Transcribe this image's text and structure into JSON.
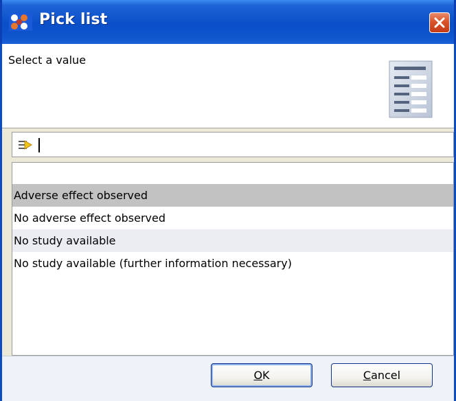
{
  "window": {
    "title": "Pick list",
    "accent": "#0a4fc8",
    "close_color": "#d9542b"
  },
  "header": {
    "label": "Select a value",
    "icon": "list-document-icon"
  },
  "filter": {
    "icon": "filter-arrow-icon",
    "value": "",
    "placeholder": ""
  },
  "list": {
    "items": [
      {
        "label": "Adverse effect observed",
        "selected": true
      },
      {
        "label": "No adverse effect observed",
        "selected": false
      },
      {
        "label": "No study available",
        "selected": false
      },
      {
        "label": "No study available (further information necessary)",
        "selected": false
      }
    ]
  },
  "buttons": {
    "ok_label": "OK",
    "cancel_label": "Cancel"
  }
}
